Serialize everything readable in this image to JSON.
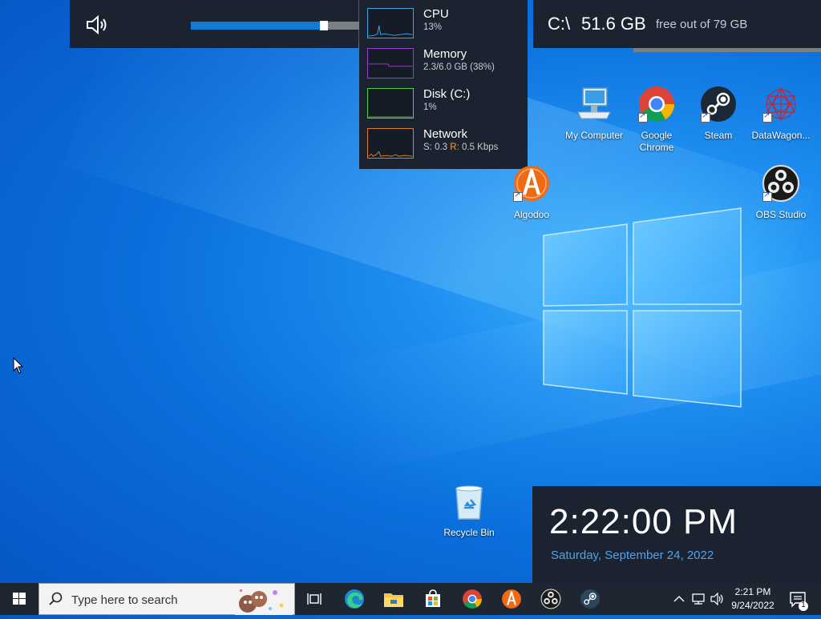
{
  "volume": {
    "value": "73",
    "level_percent": 73
  },
  "performance": {
    "rows": [
      {
        "name": "CPU",
        "value": "13%",
        "color": "#3aa6e8"
      },
      {
        "name": "Memory",
        "value": "2.3/6.0 GB (38%)",
        "color": "#9a3fcf"
      },
      {
        "name": "Disk (C:)",
        "value": "1%",
        "color": "#5fcf3f"
      },
      {
        "name": "Network",
        "send_label": "S:",
        "send_value": "0.3",
        "recv_label": "R:",
        "recv_value": "0.5 Kbps",
        "color": "#d9822b"
      }
    ]
  },
  "disk": {
    "drive": "C:\\",
    "free": "51.6 GB",
    "of_text": "free out of 79 GB"
  },
  "desktop_icons": [
    {
      "label": "My Computer",
      "icon": "computer-icon"
    },
    {
      "label": "Google Chrome",
      "icon": "chrome-icon"
    },
    {
      "label": "Steam",
      "icon": "steam-icon"
    },
    {
      "label": "DataWagon...",
      "icon": "datawagon-icon"
    },
    {
      "label": "Algodoo",
      "icon": "algodoo-icon"
    },
    {
      "label": "OBS Studio",
      "icon": "obs-icon"
    },
    {
      "label": "Recycle Bin",
      "icon": "recycle-bin-icon"
    }
  ],
  "clock": {
    "time": "2:22:00 PM",
    "date": "Saturday, September 24, 2022"
  },
  "taskbar": {
    "search_placeholder": "Type here to search",
    "pinned": [
      "task-view-icon",
      "edge-icon",
      "file-explorer-icon",
      "store-icon",
      "chrome-icon",
      "algodoo-icon",
      "obs-icon",
      "steam-icon"
    ],
    "tray_time": "2:21 PM",
    "tray_date": "9/24/2022",
    "notification_count": "1"
  },
  "colors": {
    "accent": "#1479d4",
    "widget_bg": "#1c2330",
    "taskbar_bg": "#1e2632",
    "date_blue": "#4fa3ea"
  }
}
